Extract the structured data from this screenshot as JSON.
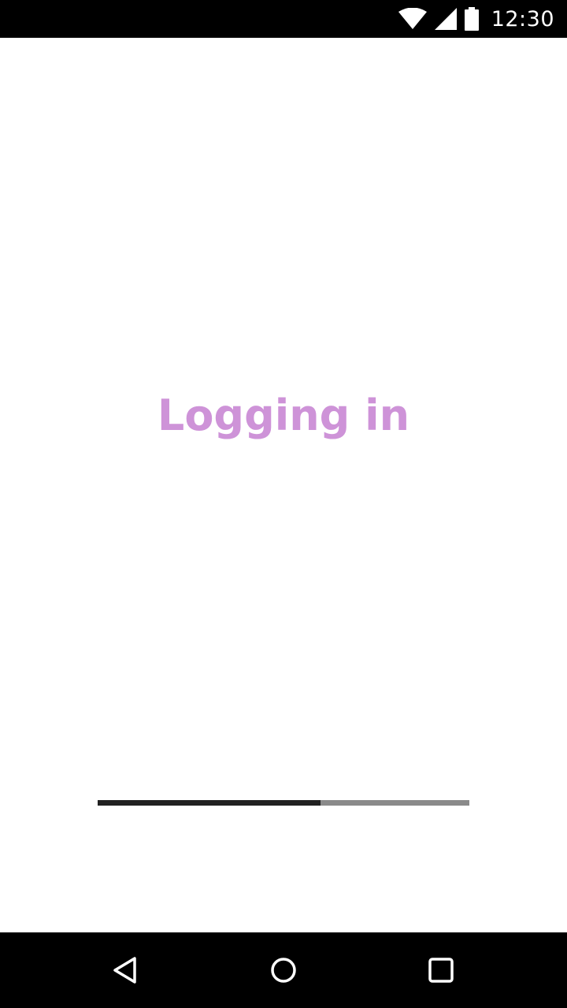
{
  "status_bar": {
    "time": "12:30",
    "icons": [
      "wifi-icon",
      "cellular-signal-icon",
      "battery-icon"
    ]
  },
  "main": {
    "title": "Logging in",
    "title_color": "#ce93d8",
    "progress": 0.6
  },
  "nav_bar": {
    "buttons": [
      "back-icon",
      "home-icon",
      "recents-icon"
    ]
  }
}
